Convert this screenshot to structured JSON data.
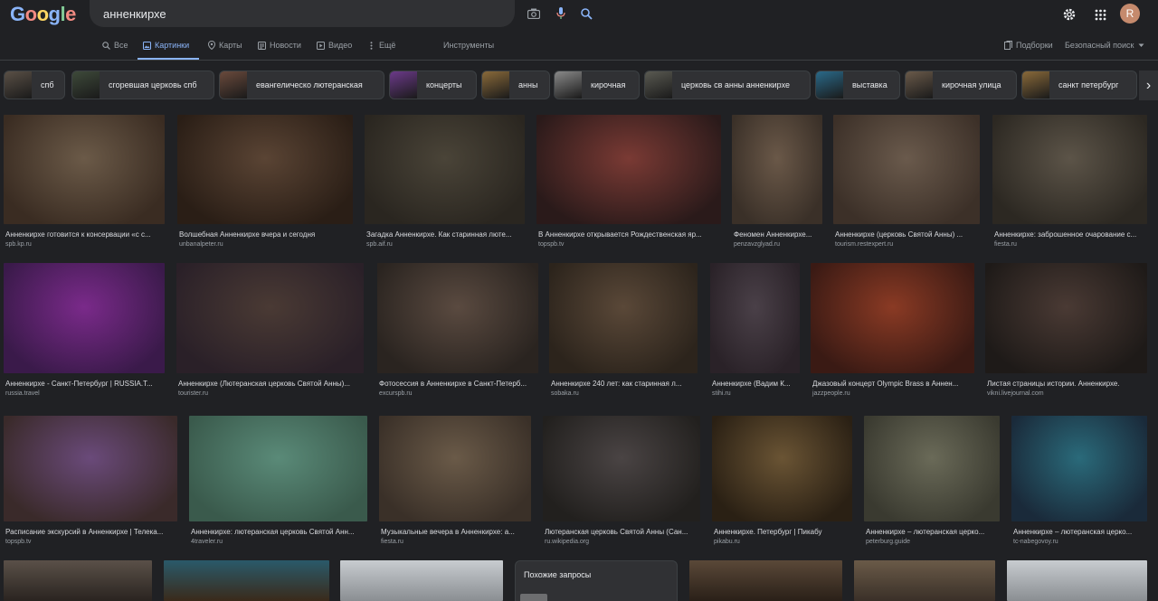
{
  "header": {
    "logo_letters": [
      {
        "ch": "G",
        "color": "#8ab4f8"
      },
      {
        "ch": "o",
        "color": "#f28b82"
      },
      {
        "ch": "o",
        "color": "#fdd663"
      },
      {
        "ch": "g",
        "color": "#8ab4f8"
      },
      {
        "ch": "l",
        "color": "#81c995"
      },
      {
        "ch": "e",
        "color": "#f28b82"
      }
    ],
    "query": "анненкирхе",
    "avatar_letter": "R"
  },
  "tabs": {
    "all": "Все",
    "images": "Картинки",
    "maps": "Карты",
    "news": "Новости",
    "video": "Видео",
    "more": "Ещё",
    "tools": "Инструменты",
    "collections": "Подборки",
    "safesearch": "Безопасный поиск"
  },
  "chips": [
    {
      "label": "спб",
      "color": "#5a5046"
    },
    {
      "label": "сгоревшая церковь спб",
      "color": "#3e4a3a"
    },
    {
      "label": "евангелическо лютеранская",
      "color": "#6a4a3c"
    },
    {
      "label": "концерты",
      "color": "#6c3a8a"
    },
    {
      "label": "анны",
      "color": "#8a6a3a"
    },
    {
      "label": "кирочная",
      "color": "#8a8a8a"
    },
    {
      "label": "церковь св анны анненкирхе",
      "color": "#5a5a52"
    },
    {
      "label": "выставка",
      "color": "#2a6a8a"
    },
    {
      "label": "кирочная улица",
      "color": "#6a5a4a"
    },
    {
      "label": "санкт петербург",
      "color": "#8a6a3a"
    }
  ],
  "rows": [
    [
      {
        "title": "Анненкирхе готовится к консервации «с с...",
        "source": "spb.kp.ru",
        "colors": [
          "#6b5a48",
          "#3a2c22"
        ]
      },
      {
        "title": "Волшебная Анненкирхе вчера и сегодня",
        "source": "unbanalpeter.ru",
        "colors": [
          "#5a4434",
          "#2a1e16"
        ]
      },
      {
        "title": "Загадка Анненкирхе. Как старинная люте...",
        "source": "spb.aif.ru",
        "colors": [
          "#4a4438",
          "#2a2620"
        ]
      },
      {
        "title": "В Анненкирхе открывается Рождественская яр...",
        "source": "topspb.tv",
        "colors": [
          "#7a3a34",
          "#2a1a1a"
        ]
      },
      {
        "title": "Феномен Анненкирхе...",
        "source": "penzavzglyad.ru",
        "colors": [
          "#6a5848",
          "#3a3028"
        ]
      },
      {
        "title": "Анненкирхе (церковь Святой Анны) ...",
        "source": "tourism.restexpert.ru",
        "colors": [
          "#6a5a4c",
          "#3c3028"
        ]
      },
      {
        "title": "Анненкирхе: заброшенное очарование с...",
        "source": "fiesta.ru",
        "colors": [
          "#5c5448",
          "#2c2822"
        ]
      }
    ],
    [
      {
        "title": "Анненкирхе - Санкт-Петербург | RUSSIA.T...",
        "source": "russia.travel",
        "colors": [
          "#7a2a8a",
          "#3a1a4a"
        ]
      },
      {
        "title": "Анненкирхе (Лютеранская церковь Святой Анны)...",
        "source": "tourister.ru",
        "colors": [
          "#4a3a34",
          "#2a2028"
        ]
      },
      {
        "title": "Фотосессия в Анненкирхе в Санкт-Петерб...",
        "source": "excurspb.ru",
        "colors": [
          "#5a4a40",
          "#2a2420"
        ]
      },
      {
        "title": "Анненкирхе 240 лет: как старинная л...",
        "source": "sobaka.ru",
        "colors": [
          "#5a4838",
          "#2c241c"
        ]
      },
      {
        "title": "Анненкирхе (Вадим К...",
        "source": "stihi.ru",
        "colors": [
          "#4a4048",
          "#2a2228"
        ]
      },
      {
        "title": "Джазовый концерт Olympic Brass в Аннен...",
        "source": "jazzpeople.ru",
        "colors": [
          "#8a3a24",
          "#3a1a14"
        ]
      },
      {
        "title": "Листая страницы истории. Анненкирхе.",
        "source": "vikni.livejournal.com",
        "colors": [
          "#4a3a34",
          "#1e1a18"
        ]
      }
    ],
    [
      {
        "title": "Расписание экскурсий в Анненкирхе | Телека...",
        "source": "topspb.tv",
        "colors": [
          "#6a4a7a",
          "#3a2a2a"
        ]
      },
      {
        "title": "Анненкирхе: лютеранская церковь Святой Анн...",
        "source": "4traveler.ru",
        "colors": [
          "#5a8a78",
          "#3a5a4c"
        ]
      },
      {
        "title": "Музыкальные вечера в Анненкирхе: а...",
        "source": "fiesta.ru",
        "colors": [
          "#6a5a48",
          "#3a3028"
        ]
      },
      {
        "title": "Лютеранская церковь Святой Анны (Сан...",
        "source": "ru.wikipedia.org",
        "colors": [
          "#4a4444",
          "#22201e"
        ]
      },
      {
        "title": "Анненкирхе. Петербург | Пикабу",
        "source": "pikabu.ru",
        "colors": [
          "#6a5434",
          "#2a2014"
        ]
      },
      {
        "title": "Анненкирхе – лютеранская церко...",
        "source": "peterburg.guide",
        "colors": [
          "#6a6a58",
          "#3a3a30"
        ]
      },
      {
        "title": "Анненкирхе – лютеранская церко...",
        "source": "tc-nabegovoy.ru",
        "colors": [
          "#2a6a7a",
          "#1a2a3a"
        ]
      }
    ]
  ],
  "bottom_row": [
    {
      "colors": [
        "#5a5048",
        "#2a2420"
      ]
    },
    {
      "colors": [
        "#2a5a6a",
        "#3a2a1a"
      ]
    },
    {
      "colors": [
        "#c8ccd0",
        "#8a8e92"
      ]
    },
    {
      "colors": [
        "#5a4838",
        "#2a2018"
      ]
    },
    {
      "colors": [
        "#6a5a48",
        "#3a3028"
      ]
    },
    {
      "colors": [
        "#c8ccd0",
        "#8a8e92"
      ]
    }
  ],
  "related": {
    "title": "Похожие запросы"
  }
}
